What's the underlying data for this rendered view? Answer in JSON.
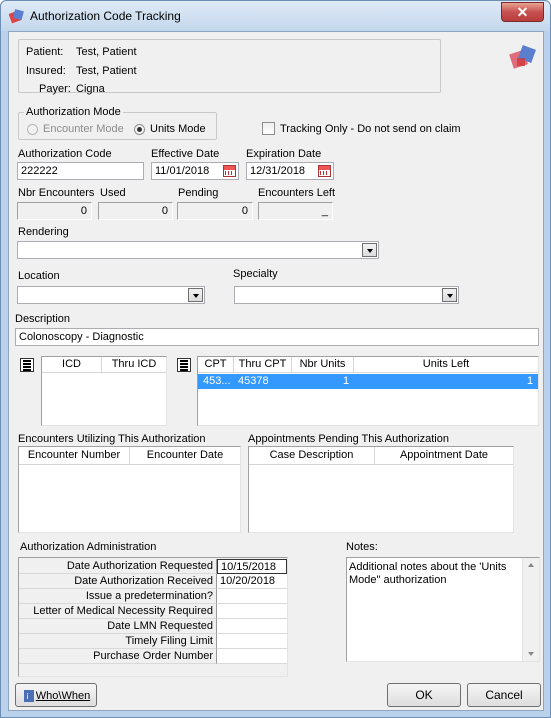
{
  "window": {
    "title": "Authorization Code Tracking",
    "close_label": "✕"
  },
  "patient_info": {
    "patient_label": "Patient:",
    "patient_value": "Test, Patient",
    "insured_label": "Insured:",
    "insured_value": "Test, Patient",
    "payer_label": "Payer:",
    "payer_value": "Cigna"
  },
  "auth_mode": {
    "group_label": "Authorization Mode",
    "encounter_mode_label": "Encounter Mode",
    "units_mode_label": "Units Mode",
    "selected": "Units Mode"
  },
  "tracking_only": {
    "label": "Tracking Only - Do not send on claim",
    "checked": false
  },
  "auth_code": {
    "label": "Authorization Code",
    "value": "222222"
  },
  "effective_date": {
    "label": "Effective Date",
    "value": "11/01/2018"
  },
  "expiration_date": {
    "label": "Expiration Date",
    "value": "12/31/2018"
  },
  "counters": {
    "nbr_encounters_label": "Nbr Encounters",
    "nbr_encounters_value": "0",
    "used_label": "Used",
    "used_value": "0",
    "pending_label": "Pending",
    "pending_value": "0",
    "encounters_left_label": "Encounters Left",
    "encounters_left_value": "_"
  },
  "rendering": {
    "label": "Rendering",
    "value": ""
  },
  "location": {
    "label": "Location",
    "value": ""
  },
  "specialty": {
    "label": "Specialty",
    "value": ""
  },
  "description": {
    "label": "Description",
    "value": "Colonoscopy - Diagnostic"
  },
  "icd_grid": {
    "columns": [
      "ICD",
      "Thru ICD"
    ],
    "rows": []
  },
  "cpt_grid": {
    "columns": [
      "CPT",
      "Thru CPT",
      "Nbr Units",
      "Units Left"
    ],
    "rows": [
      {
        "cpt": "453...",
        "thru_cpt": "45378",
        "nbr_units": "1",
        "units_left": "1"
      }
    ]
  },
  "encounters_grid": {
    "label": "Encounters Utilizing This Authorization",
    "columns": [
      "Encounter Number",
      "Encounter Date"
    ]
  },
  "appointments_grid": {
    "label": "Appointments Pending This Authorization",
    "columns": [
      "Case Description",
      "Appointment Date"
    ]
  },
  "admin": {
    "label": "Authorization Administration",
    "rows": [
      {
        "label": "Date Authorization Requested",
        "value": "10/15/2018"
      },
      {
        "label": "Date Authorization Received",
        "value": "10/20/2018"
      },
      {
        "label": "Issue a predetermination?",
        "value": ""
      },
      {
        "label": "Letter of Medical Necessity Required",
        "value": ""
      },
      {
        "label": "Date LMN Requested",
        "value": ""
      },
      {
        "label": "Timely Filing Limit",
        "value": ""
      },
      {
        "label": "Purchase Order Number",
        "value": ""
      }
    ]
  },
  "notes": {
    "label": "Notes:",
    "value": "Additional notes about the 'Units Mode\" authorization"
  },
  "buttons": {
    "who_when": "Who\\When",
    "ok": "OK",
    "cancel": "Cancel"
  },
  "colors": {
    "selection": "#3399ff",
    "title_bar": "#c3d7ec",
    "close_button": "#c75050"
  }
}
